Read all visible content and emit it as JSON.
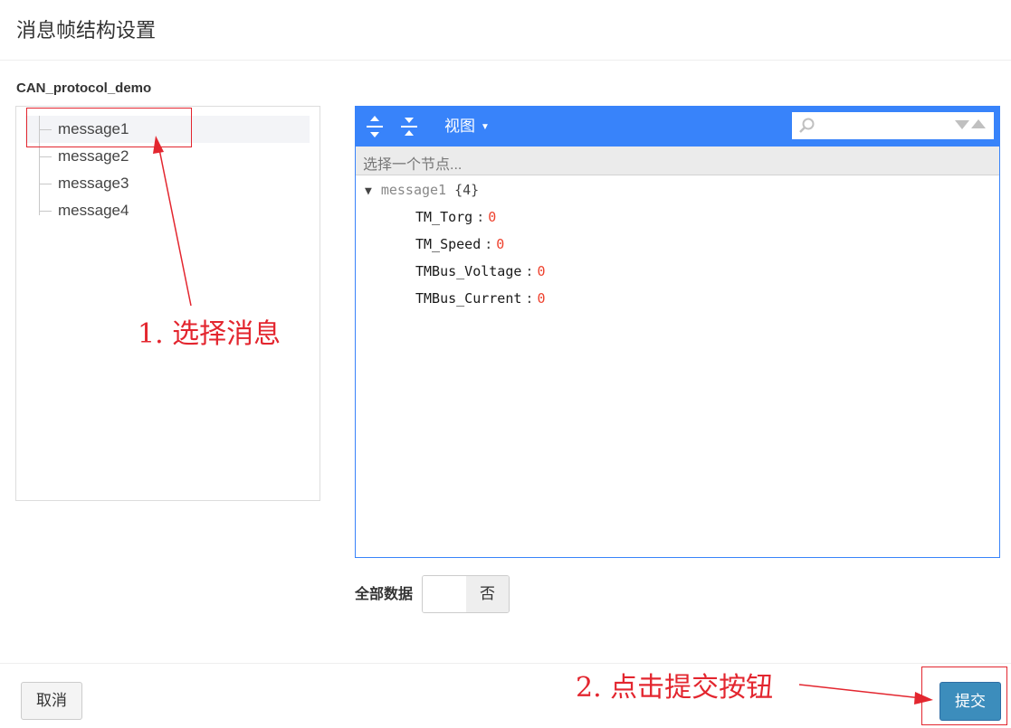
{
  "dialog": {
    "title": "消息帧结构设置"
  },
  "tree": {
    "protocol_name": "CAN_protocol_demo",
    "items": [
      {
        "label": "message1",
        "selected": true
      },
      {
        "label": "message2",
        "selected": false
      },
      {
        "label": "message3",
        "selected": false
      },
      {
        "label": "message4",
        "selected": false
      }
    ]
  },
  "editor": {
    "menu": {
      "expand_icon": "expand-all-icon",
      "collapse_icon": "collapse-all-icon",
      "view_label": "视图",
      "search_placeholder": ""
    },
    "navbar": {
      "text": "选择一个节点..."
    },
    "root": {
      "key": "message1",
      "count": "{4}"
    },
    "fields": [
      {
        "key": "TM_Torg",
        "value": "0"
      },
      {
        "key": "TM_Speed",
        "value": "0"
      },
      {
        "key": "TMBus_Voltage",
        "value": "0"
      },
      {
        "key": "TMBus_Current",
        "value": "0"
      }
    ],
    "colors": {
      "menu": "#3883fa",
      "number": "#ee422e"
    }
  },
  "full_data": {
    "label": "全部数据",
    "value": "否"
  },
  "footer": {
    "cancel_label": "取消",
    "submit_label": "提交"
  },
  "annotations": {
    "step1": "1. 选择消息",
    "step2": "2. 点击提交按钮",
    "color": "#e3262f"
  }
}
